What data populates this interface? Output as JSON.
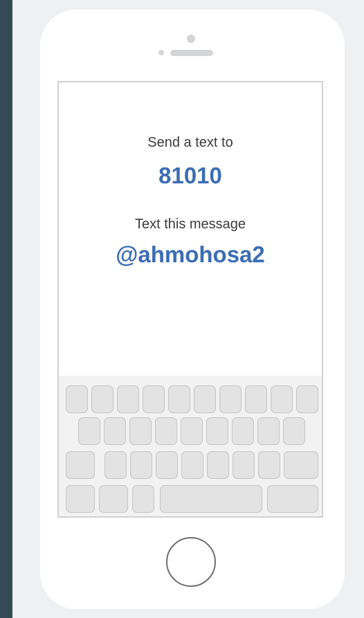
{
  "instructions": {
    "send_label": "Send a text to",
    "phone_number": "81010",
    "message_label": "Text this message",
    "keyword": "@ahmohosa2"
  },
  "colors": {
    "background": "#344a56",
    "panel": "#eef0f2",
    "accent": "#3c6db4",
    "text": "#3b3b3b"
  }
}
